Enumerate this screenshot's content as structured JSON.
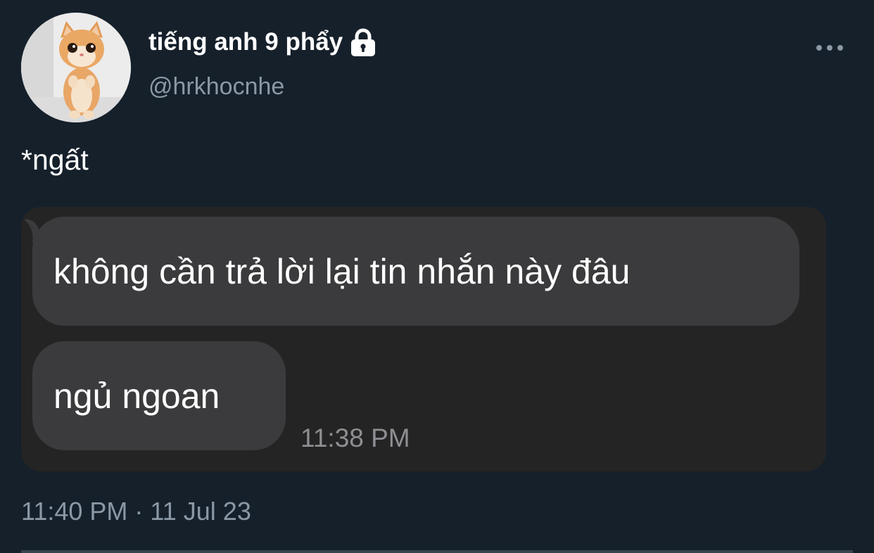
{
  "tweet": {
    "author": {
      "display_name": "tiếng anh 9 phẩy",
      "handle": "@hrkhocnhe",
      "avatar": "kitten-avatar",
      "protected_icon": "lock-icon"
    },
    "more_icon": "more-horizontal-icon",
    "text": "*ngất",
    "timestamp": "11:40 PM · 11 Jul 23"
  },
  "screenshot": {
    "messages": [
      "không cần trả lời lại tin nhắn này đâu",
      "ngủ ngoan"
    ],
    "time": "11:38 PM"
  },
  "colors": {
    "background": "#15202b",
    "secondary_text": "#8b98a5",
    "bubble": "#3b3b3d",
    "message_panel": "#242424"
  }
}
